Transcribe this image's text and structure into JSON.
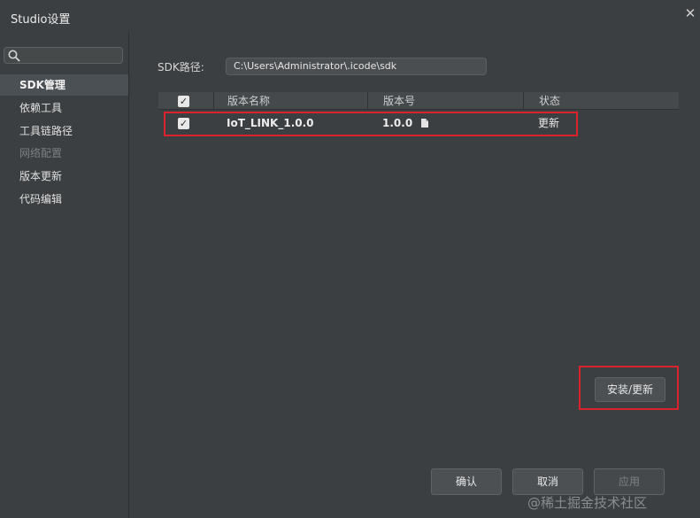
{
  "window": {
    "title": "Studio设置"
  },
  "sidebar": {
    "items": [
      {
        "label": "SDK管理"
      },
      {
        "label": "依赖工具"
      },
      {
        "label": "工具链路径"
      },
      {
        "label": "网络配置"
      },
      {
        "label": "版本更新"
      },
      {
        "label": "代码编辑"
      }
    ]
  },
  "sdk": {
    "path_label": "SDK路径:",
    "path_value": "C:\\Users\\Administrator\\.icode\\sdk"
  },
  "table": {
    "headers": [
      "版本名称",
      "版本号",
      "状态"
    ],
    "rows": [
      {
        "name": "IoT_LINK_1.0.0",
        "version": "1.0.0",
        "status": "更新"
      }
    ]
  },
  "actions": {
    "install_label": "安装/更新"
  },
  "footer": {
    "ok": "确认",
    "cancel": "取消",
    "apply": "应用"
  },
  "watermark": "@稀土掘金技术社区",
  "colors": {
    "highlight": "#d9222a",
    "background": "#3c3f41"
  }
}
